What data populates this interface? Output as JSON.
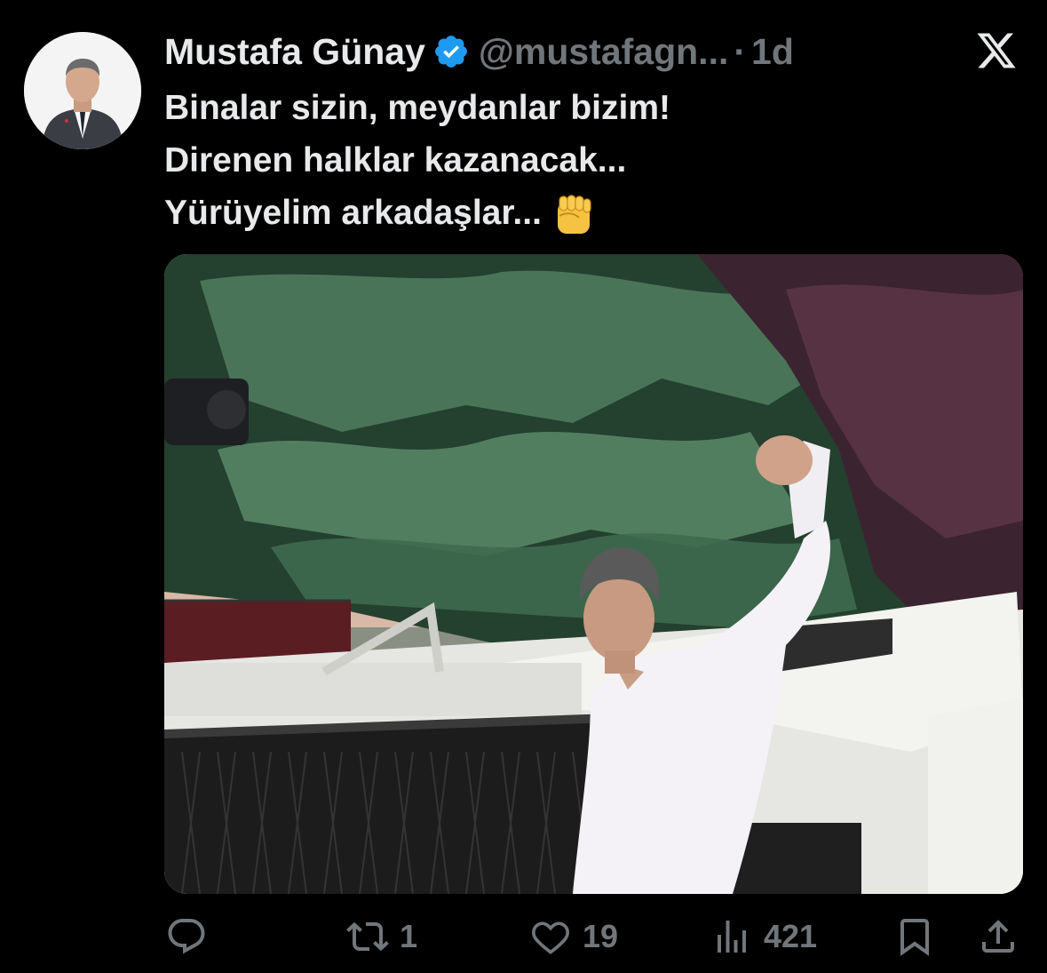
{
  "author": {
    "display_name": "Mustafa Günay",
    "handle": "@mustafagn...",
    "separator": "·",
    "time": "1d"
  },
  "tweet": {
    "lines": [
      "Binalar sizin, meydanlar bizim!",
      "Direnen halklar kazanacak...",
      "Yürüyelim arkadaşlar..."
    ],
    "emoji": "✊"
  },
  "actions": {
    "reply_count": "",
    "retweet_count": "1",
    "like_count": "19",
    "views_count": "421"
  },
  "icons": {
    "logo": "x-logo-icon",
    "verified": "verified-badge-icon",
    "reply": "reply-icon",
    "retweet": "retweet-icon",
    "like": "heart-icon",
    "views": "views-icon",
    "bookmark": "bookmark-icon",
    "share": "share-icon"
  },
  "colors": {
    "background": "#000000",
    "text": "#e7e9ea",
    "muted": "#71767b",
    "verified": "#1d9bf0"
  }
}
